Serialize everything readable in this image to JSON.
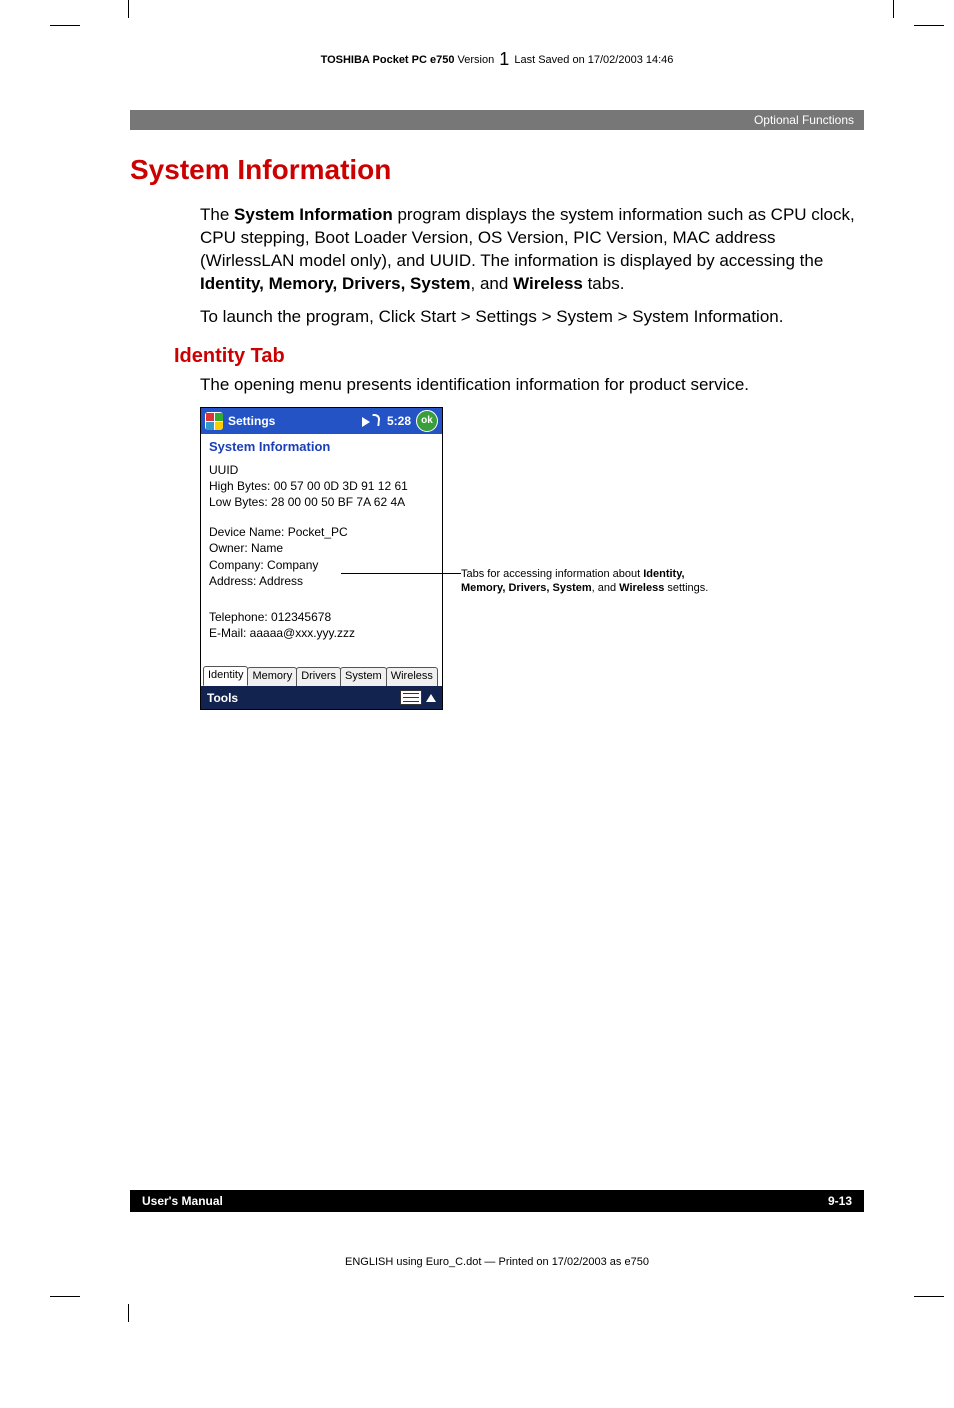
{
  "running_header": {
    "product": "TOSHIBA Pocket PC e750",
    "version_label": "Version",
    "version_num": "1",
    "saved": "Last Saved on 17/02/2003 14:46"
  },
  "section_bar": "Optional Functions",
  "h1": "System Information",
  "p1_a": "The ",
  "p1_b": "System Information",
  "p1_c": " program displays the system information such as CPU clock, CPU stepping, Boot Loader Version, OS Version, PIC Version, MAC address (WirlessLAN model only), and UUID. The information is displayed by accessing the ",
  "p1_d": "Identity, Memory, Drivers, System",
  "p1_e": ", and ",
  "p1_f": "Wireless",
  "p1_g": " tabs.",
  "p2": "To launch the program, Click Start > Settings > System > System Information.",
  "h2": "Identity Tab",
  "p3": "The opening menu presents identification information for product service.",
  "ppc": {
    "title": "Settings",
    "clock": "5:28",
    "ok": "ok",
    "subtitle": "System Information",
    "uuid_label": "UUID",
    "uuid_high": "High Bytes: 00 57 00 0D 3D 91 12 61",
    "uuid_low": "Low Bytes: 28 00 00 50 BF 7A 62 4A",
    "device": "Device Name: Pocket_PC",
    "owner": "Owner: Name",
    "company": "Company: Company",
    "address": "Address: Address",
    "telephone": "Telephone: 012345678",
    "email": "E-Mail: aaaaa@xxx.yyy.zzz",
    "tabs": [
      "Identity",
      "Memory",
      "Drivers",
      "System",
      "Wireless"
    ],
    "footer": "Tools"
  },
  "callout_a": "Tabs for accessing information about ",
  "callout_b": "Identity, Memory, Drivers, System",
  "callout_c": ", and ",
  "callout_d": "Wireless",
  "callout_e": " settings.",
  "footer_left": "User's Manual",
  "footer_right": "9-13",
  "print_footer": "ENGLISH using Euro_C.dot — Printed on 17/02/2003 as e750"
}
